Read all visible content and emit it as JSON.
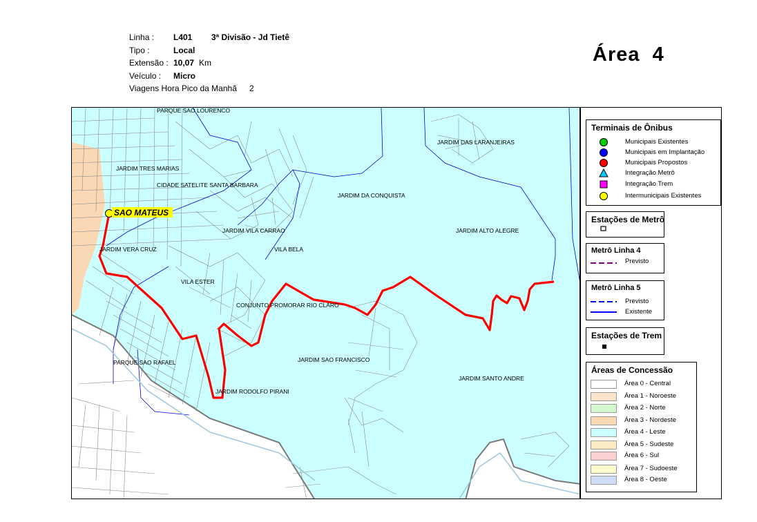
{
  "header": {
    "linha_label": "Linha :",
    "linha_code": "L401",
    "linha_name": "3ª Divisão - Jd Tietê",
    "tipo_label": "Tipo :",
    "tipo_value": "Local",
    "extensao_label": "Extensão :",
    "extensao_value": "10,07",
    "extensao_unit": "Km",
    "veiculo_label": "Veículo :",
    "veiculo_value": "Micro",
    "viagens_label": "Viagens Hora Pico da Manhã",
    "viagens_value": "2"
  },
  "area_title": "Área  4",
  "map": {
    "labels": {
      "parque_sao_lourenco": "PARQUE SAO LOURENCO",
      "jardim_das_laranjeiras": "JARDIM DAS LARANJEIRAS",
      "jardim_tres_marias": "JARDIM TRES MARIAS",
      "cidade_satelite": "CIDADE SATELITE SANTA BARBARA",
      "jardim_da_conquista": "JARDIM DA CONQUISTA",
      "sao_mateus": "SAO MATEUS",
      "jardim_vila_carrao": "JARDIM VILA CARRAO",
      "jardim_alto_alegre": "JARDIM ALTO ALEGRE",
      "jardim_vera_cruz": "JARDIM VERA CRUZ",
      "vila_bela": "VILA BELA",
      "vila_ester": "VILA ESTER",
      "conjunto_promorar": "CONJUNTO PROMORAR RIO CLARO",
      "parque_sao_rafael": "PARQUE SAO RAFAEL",
      "jardim_sao_francisco": "JARDIM SAO FRANCISCO",
      "jardim_santo_andre": "JARDIM SANTO ANDRE",
      "jardim_rodolfo_pirani": "JARDIM RODOLFO PIRANI"
    },
    "colors": {
      "area4": "#ccffff",
      "area3": "#fbd8b4",
      "route": "#ff0000",
      "streets": "#8c8c8c",
      "metro5": "#0000e0",
      "boundary": "#7a7a7a",
      "river": "#9ec6de"
    }
  },
  "legend": {
    "terminais": {
      "title": "Terminais de Ônibus",
      "items": [
        {
          "label": "Municipais Existentes",
          "color": "#00cc00",
          "icon": "circle-icon"
        },
        {
          "label": "Municipais em Implantação",
          "color": "#0000ff",
          "icon": "circle-icon"
        },
        {
          "label": "Municipais Propostos",
          "color": "#ff0000",
          "icon": "circle-icon"
        },
        {
          "label": "Integração Metrô",
          "color": "#00ccff",
          "icon": "triangle-icon"
        },
        {
          "label": "Integração Trem",
          "color": "#ff00ff",
          "icon": "square-icon"
        },
        {
          "label": "Intermunicipais Existentes",
          "color": "#ffff00",
          "icon": "circle-icon"
        }
      ]
    },
    "estacoes_metro": {
      "title": "Estações de Metrô"
    },
    "metro4": {
      "title": "Metrô Linha 4",
      "previsto": "Previsto",
      "color": "#800080"
    },
    "metro5": {
      "title": "Metrô Linha 5",
      "previsto": "Previsto",
      "existente": "Existente",
      "color": "#0000ff"
    },
    "estacoes_trem": {
      "title": "Estações de Trem"
    },
    "areas": {
      "title": "Áreas de Concessão",
      "items": [
        {
          "label": "Área 0 - Central",
          "color": "#ffffff"
        },
        {
          "label": "Área 1 - Noroeste",
          "color": "#fbe3cc"
        },
        {
          "label": "Área 2 - Norte",
          "color": "#d4f7cf"
        },
        {
          "label": "Área 3 - Nordeste",
          "color": "#fbd8b4"
        },
        {
          "label": "Área 4 - Leste",
          "color": "#ccffff"
        },
        {
          "label": "Área 5 - Sudeste",
          "color": "#fcecc4"
        },
        {
          "label": "Área 6 - Sul",
          "color": "#fcd0d0"
        },
        {
          "label": "Área 7 - Sudoeste",
          "color": "#fcfccc"
        },
        {
          "label": "Área 8 - Oeste",
          "color": "#cfdcf5"
        }
      ]
    }
  }
}
